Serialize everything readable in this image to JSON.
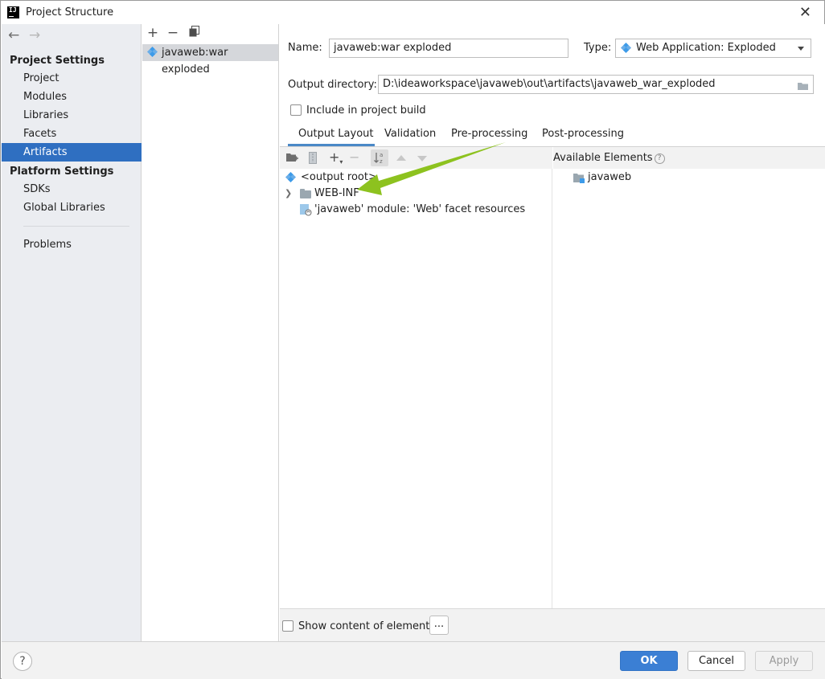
{
  "window": {
    "title": "Project Structure",
    "app_icon_text": "IJ"
  },
  "nav": {
    "project_settings_header": "Project Settings",
    "project_settings_items": [
      "Project",
      "Modules",
      "Libraries",
      "Facets",
      "Artifacts"
    ],
    "selected": "Artifacts",
    "platform_settings_header": "Platform Settings",
    "platform_settings_items": [
      "SDKs",
      "Global Libraries"
    ],
    "problems": "Problems"
  },
  "artifacts": {
    "items": [
      "javaweb:war exploded"
    ]
  },
  "form": {
    "name_label": "Name:",
    "name_value": "javaweb:war exploded",
    "type_label": "Type:",
    "type_value": "Web Application: Exploded",
    "output_dir_label": "Output directory:",
    "output_dir_value": "D:\\ideaworkspace\\javaweb\\out\\artifacts\\javaweb_war_exploded",
    "include_build_label": "Include in project build",
    "include_build_checked": false
  },
  "tabs": [
    {
      "label": "Output Layout",
      "active": true
    },
    {
      "label": "Validation",
      "active": false
    },
    {
      "label": "Pre-processing",
      "active": false
    },
    {
      "label": "Post-processing",
      "active": false
    }
  ],
  "tree": {
    "root": "<output root>",
    "items": [
      "WEB-INF",
      "'javaweb' module: 'Web' facet resources"
    ]
  },
  "available": {
    "header": "Available Elements",
    "help_glyph": "?",
    "items": [
      "javaweb"
    ]
  },
  "bottom": {
    "show_content_label": "Show content of elements",
    "show_content_checked": false,
    "more_button": "..."
  },
  "footer": {
    "help": "?",
    "ok": "OK",
    "cancel": "Cancel",
    "apply": "Apply"
  },
  "colors": {
    "selection": "#2f6fc1",
    "annotation_arrow": "#8dc21f",
    "primary_button": "#3b7fd4"
  }
}
